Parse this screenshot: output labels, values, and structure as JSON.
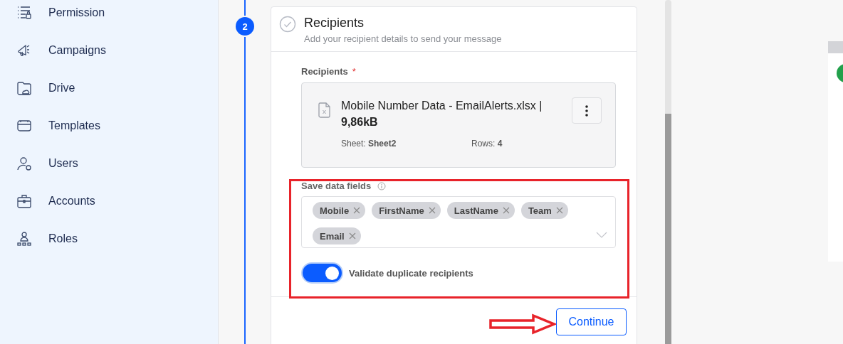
{
  "sidebar": {
    "items": [
      {
        "label": "Permission"
      },
      {
        "label": "Campaigns"
      },
      {
        "label": "Drive"
      },
      {
        "label": "Templates"
      },
      {
        "label": "Users"
      },
      {
        "label": "Accounts"
      },
      {
        "label": "Roles"
      }
    ]
  },
  "step": {
    "number": "2",
    "title": "Recipients",
    "subtitle": "Add your recipient details to send your message"
  },
  "recipients": {
    "label": "Recipients",
    "required_mark": "*",
    "file_name": "Mobile Number Data - EmailAlerts.xlsx | **9,86kB**",
    "sheet": "Sheet: **Sheet2**",
    "rows": "Rows: **4**"
  },
  "data_fields": {
    "label": "Save data fields",
    "tags": [
      "Mobile",
      "FirstName",
      "LastName",
      "Team",
      "Email"
    ]
  },
  "toggle": {
    "label": "Validate duplicate recipients",
    "on": true
  },
  "continue_button": "Continue"
}
